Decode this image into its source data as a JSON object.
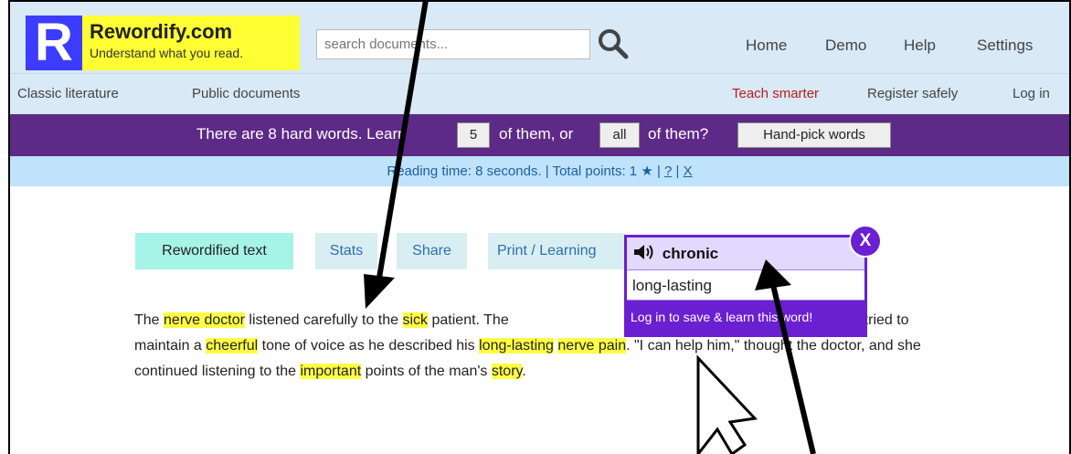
{
  "logo": {
    "letter": "R",
    "name": "Rewordify.com",
    "tagline": "Understand what you read."
  },
  "search": {
    "placeholder": "search documents..."
  },
  "topnav": [
    "Home",
    "Demo",
    "Help",
    "Settings"
  ],
  "subnav": {
    "left": [
      "Classic literature",
      "Public documents"
    ],
    "right_highlight": "Teach smarter",
    "right": [
      "Register safely",
      "Log in"
    ]
  },
  "purplebar": {
    "text1": "There are 8 hard words. Learn",
    "btn_count": "5",
    "text2": "of them, or",
    "btn_all": "all",
    "text3": "of them?",
    "btn_pick": "Hand-pick words"
  },
  "infobar": {
    "text": "Reading time: 8 seconds. | Total points: 1",
    "star": "★",
    "sep": "|",
    "help": "?",
    "close": "X"
  },
  "tabs": [
    "Rewordified text",
    "Stats",
    "Share",
    "Print / Learning"
  ],
  "paragraph": {
    "s1": "The ",
    "h1": "nerve doctor",
    "s2": " listened carefully to the ",
    "h2": "sick",
    "s3": " patient. The ",
    "s3b": " man of 55, tried to maintain a ",
    "h3": "cheerful",
    "s4": " tone of voice as he described his ",
    "h4": "long-lasting",
    "s5": " ",
    "h5": "nerve pain",
    "s6": ". \"I can help him,\" thought the doctor, and she continued listening to the ",
    "h6": "important",
    "s7": " points of the man's ",
    "h7": "story",
    "s8": "."
  },
  "popup": {
    "speaker_icon": "speaker-icon",
    "word": "chronic",
    "definition": "long-lasting",
    "footer": "Log in to save & learn this word!",
    "close": "X"
  },
  "colors": {
    "purple": "#5e2a87",
    "popup_purple": "#6a1fd1",
    "highlight": "#ffff44",
    "logo_blue": "#3c3cff"
  }
}
